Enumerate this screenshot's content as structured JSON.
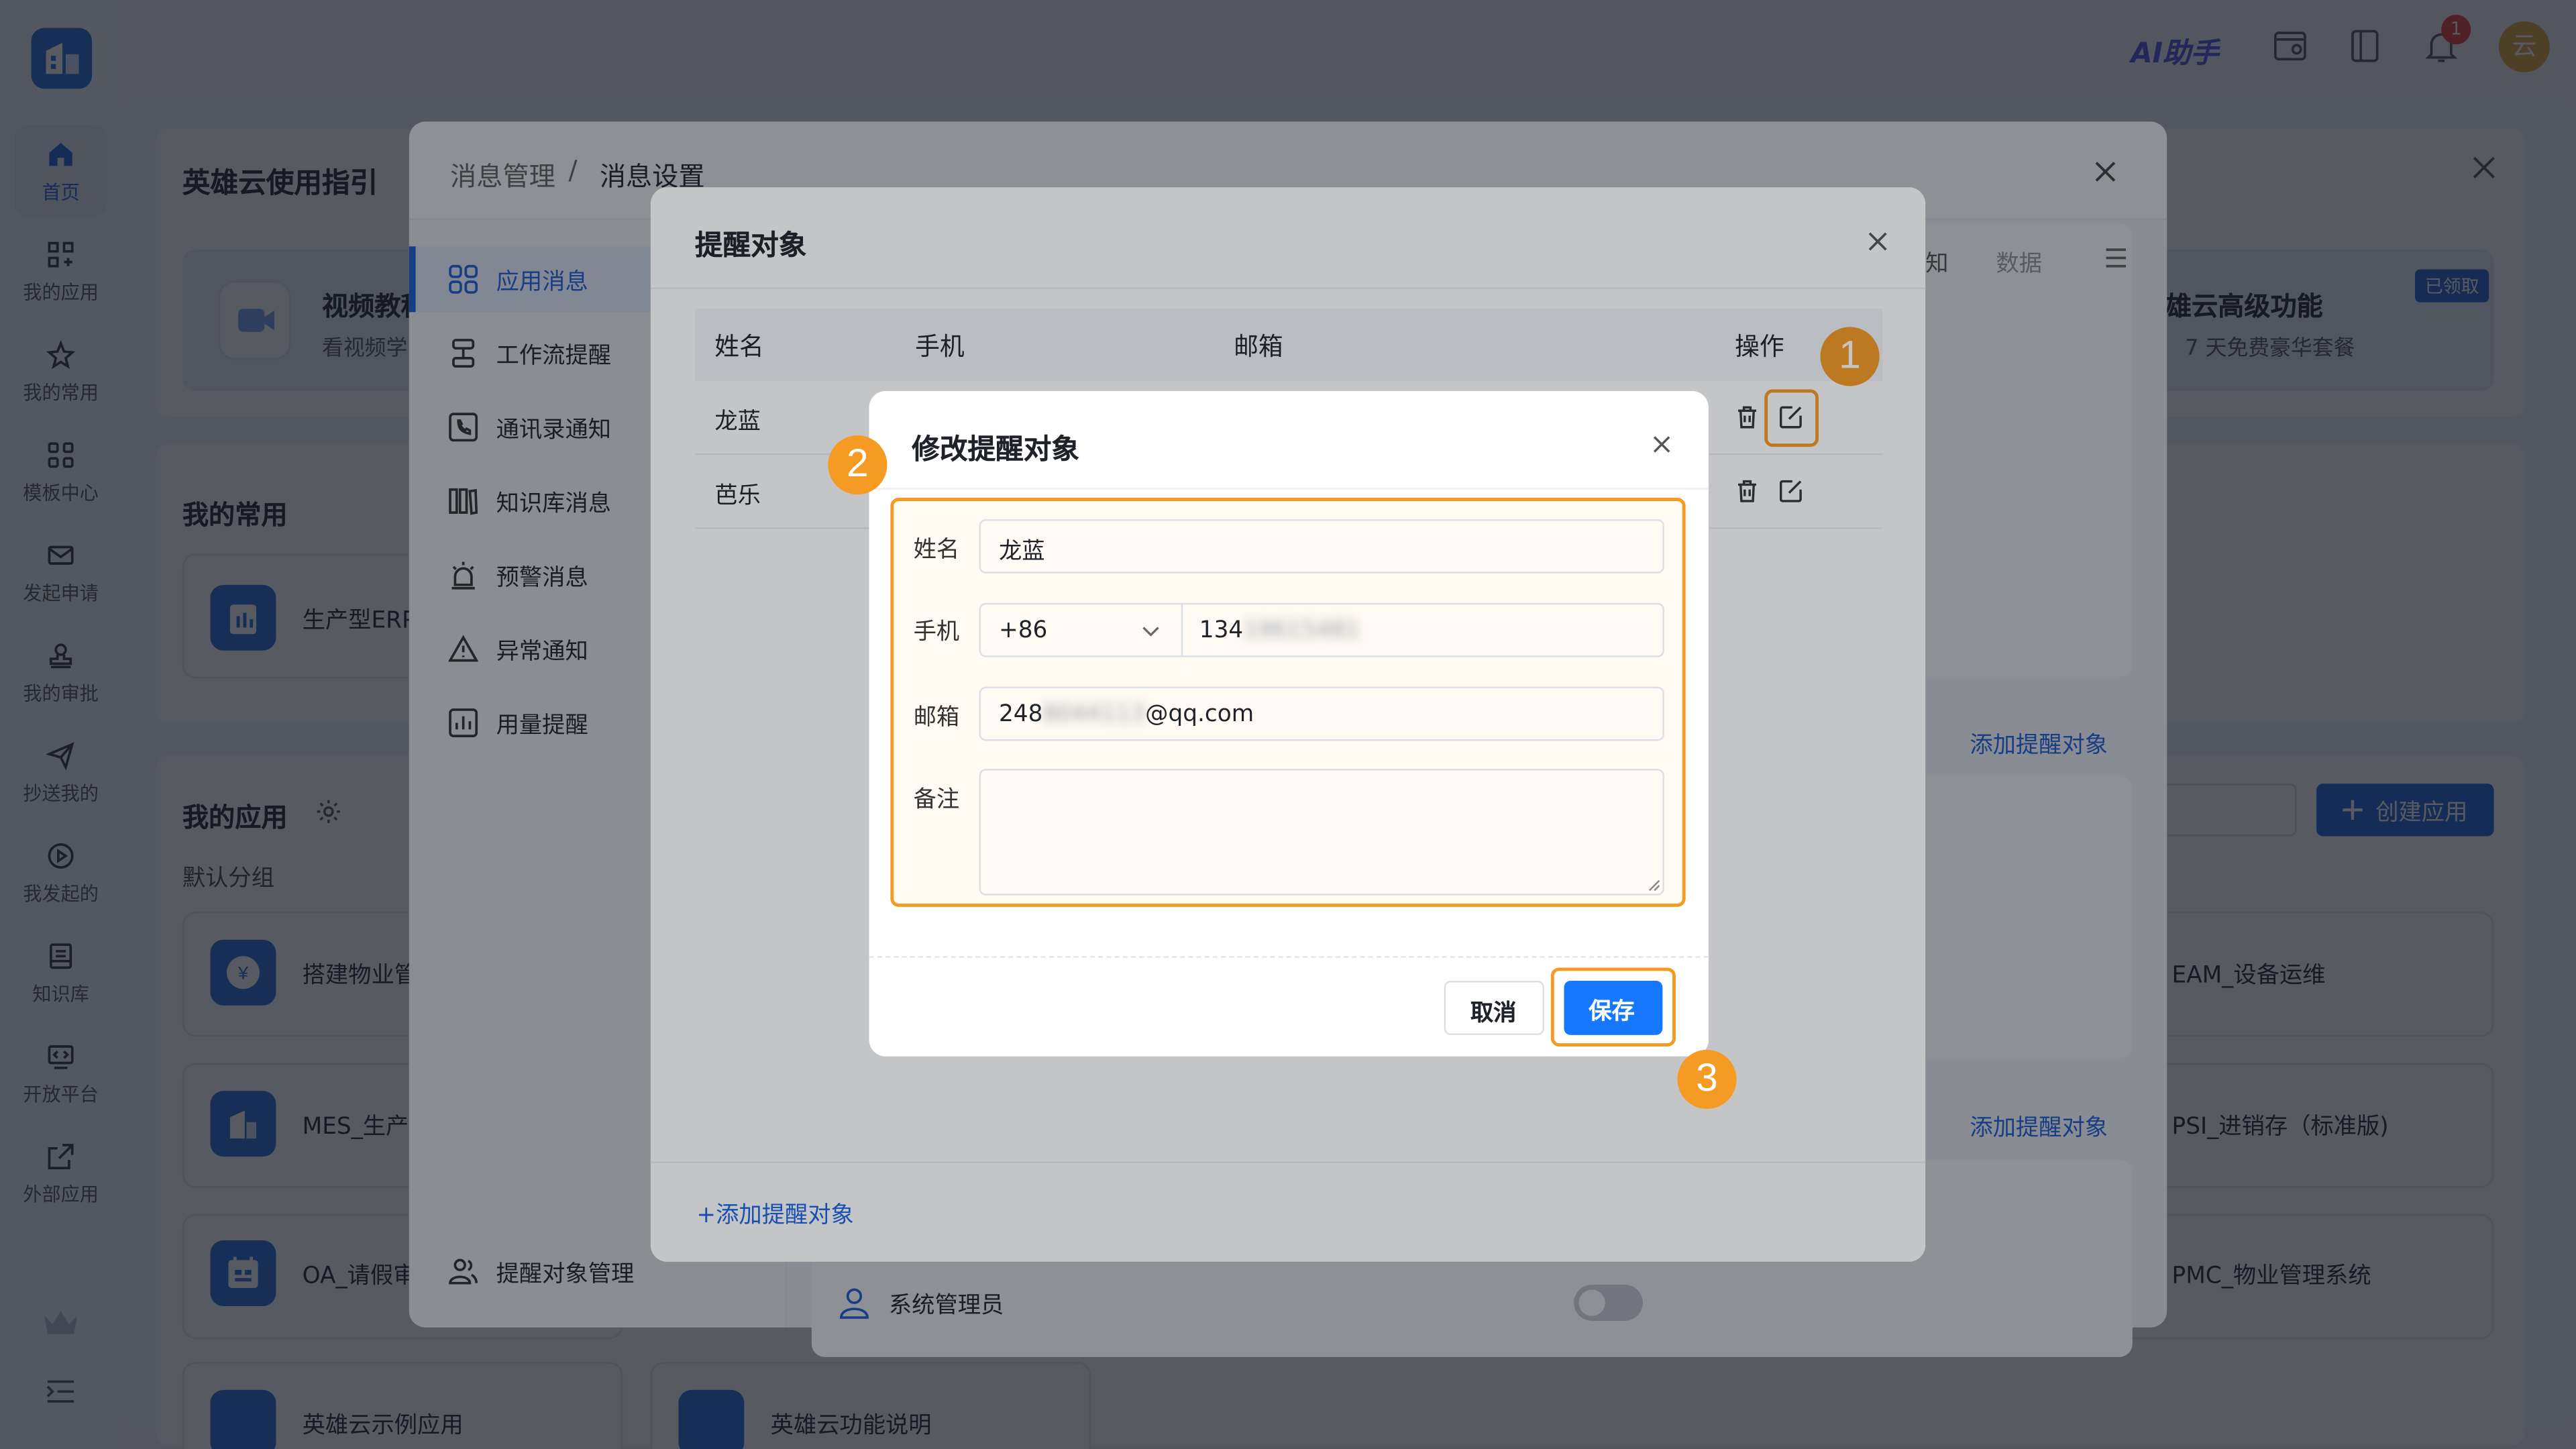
{
  "topbar": {
    "ai_label": "AI助手",
    "notif_count": "1",
    "avatar_text": "云"
  },
  "rail": {
    "items": [
      "首页",
      "我的应用",
      "我的常用",
      "模板中心",
      "发起申请",
      "我的审批",
      "抄送我的",
      "我发起的",
      "知识库",
      "开放平台",
      "外部应用"
    ]
  },
  "home": {
    "guide_title": "英雄云使用指引",
    "video_title": "视频教程",
    "video_sub": "看视频学",
    "premium_title": "雄云高级功能",
    "premium_sub": "7 天免费豪华套餐",
    "premium_badge": "已领取",
    "common_title": "我的常用",
    "common_app": "生产型ERP",
    "apps_title": "我的应用",
    "default_group": "默认分组",
    "create_app": "创建应用",
    "apps": [
      "搭建物业管",
      "MES_生产执",
      "OA_请假审",
      "英雄云示例应用",
      "英雄云功能说明",
      "EAM_设备运维",
      "PSI_进销存（标准版)",
      "PMC_物业管理系统"
    ]
  },
  "msg_dialog": {
    "breadcrumb_parent": "消息管理",
    "breadcrumb_sep": "/",
    "breadcrumb_current": "消息设置",
    "menu": [
      "应用消息",
      "工作流提醒",
      "通讯录通知",
      "知识库消息",
      "预警消息",
      "异常通知",
      "用量提醒"
    ],
    "bottom_menu": "提醒对象管理",
    "tab_partial_1": "知",
    "tab_partial_2": "数据",
    "add_object_link": "添加提醒对象",
    "system_admin": "系统管理员"
  },
  "recipients_dialog": {
    "title": "提醒对象",
    "columns": {
      "name": "姓名",
      "phone": "手机",
      "email": "邮箱",
      "action": "操作"
    },
    "rows": [
      {
        "name": "龙蓝"
      },
      {
        "name": "芭乐"
      }
    ],
    "add_link": "+添加提醒对象"
  },
  "edit_dialog": {
    "title": "修改提醒对象",
    "name_label": "姓名",
    "name_value": "龙蓝",
    "phone_label": "手机",
    "country_code": "+86",
    "phone_prefix": "134",
    "phone_hidden": "19615481",
    "email_label": "邮箱",
    "email_prefix": "248",
    "email_hidden": "8044113",
    "email_suffix": "@qq.com",
    "note_label": "备注",
    "note_value": "",
    "cancel": "取消",
    "save": "保存"
  },
  "steps": [
    "1",
    "2",
    "3"
  ],
  "colors": {
    "primary": "#1b62e0",
    "accent": "#f59a23",
    "save": "#1677ff"
  }
}
